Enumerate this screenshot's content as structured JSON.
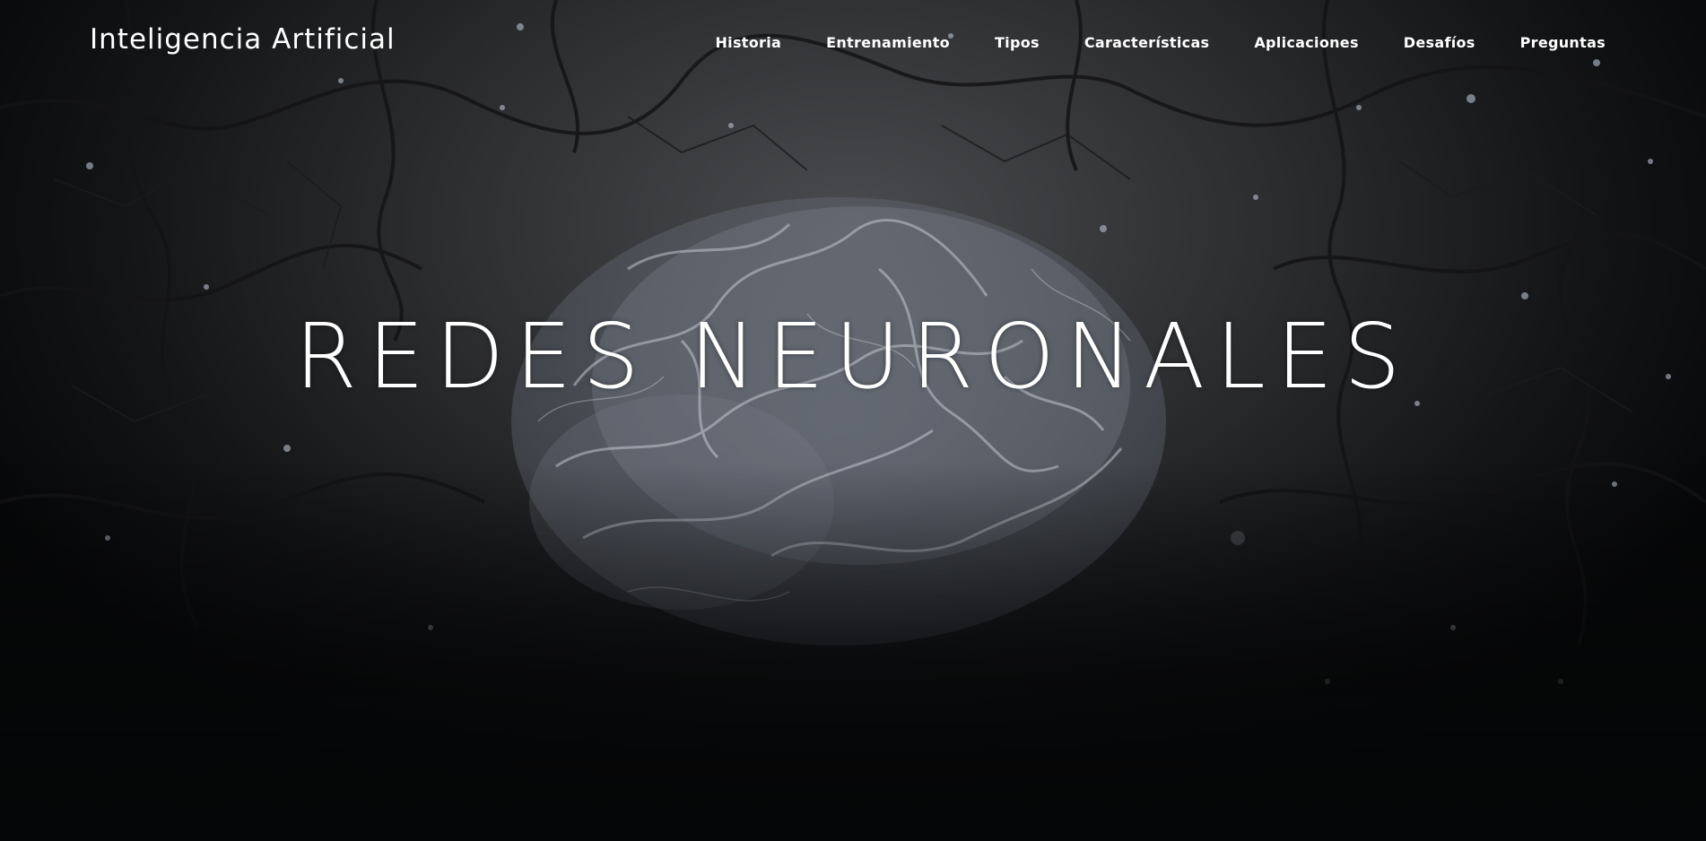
{
  "navbar": {
    "brand": "Inteligencia Artificial",
    "links": [
      {
        "label": "Historia"
      },
      {
        "label": "Entrenamiento"
      },
      {
        "label": "Tipos"
      },
      {
        "label": "Características"
      },
      {
        "label": "Aplicaciones"
      },
      {
        "label": "Desafíos"
      },
      {
        "label": "Preguntas"
      }
    ]
  },
  "hero": {
    "title": "REDES NEURONALES",
    "background_image": "neural-brain-cracked-background"
  },
  "colors": {
    "text": "#ffffff",
    "background_dark": "#050607",
    "background_mid": "#2a2b2d"
  }
}
